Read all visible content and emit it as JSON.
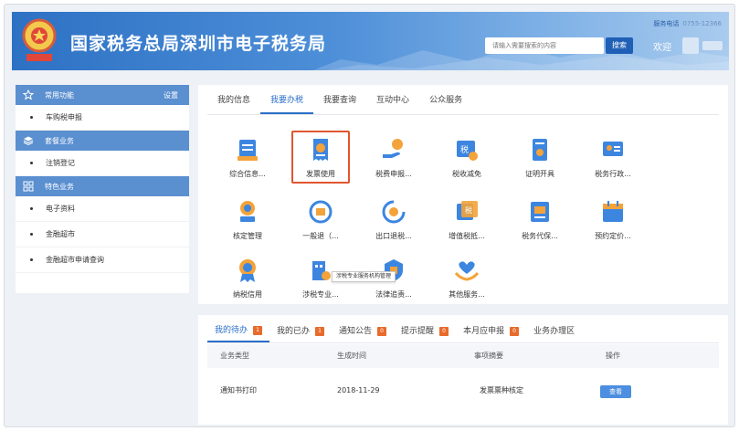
{
  "header": {
    "title": "国家税务总局深圳市电子税务局",
    "service_phone_label": "服务电话",
    "service_phone": "0755-12366",
    "search_placeholder": "请输入需要搜索的内容",
    "search_button": "搜索",
    "welcome": "欢迎"
  },
  "sidebar": {
    "sections": [
      {
        "label": "常用功能",
        "right": "设置",
        "icon": "star-icon",
        "items": [
          "车购税申报"
        ]
      },
      {
        "label": "套餐业务",
        "right": "",
        "icon": "package-icon",
        "items": [
          "注销登记"
        ]
      },
      {
        "label": "特色业务",
        "right": "",
        "icon": "grid-icon",
        "items": [
          "电子资料",
          "金融超市",
          "金融超市申请查询"
        ]
      }
    ]
  },
  "main": {
    "tabs": [
      {
        "label": "我的信息",
        "active": false
      },
      {
        "label": "我要办税",
        "active": true
      },
      {
        "label": "我要查询",
        "active": false
      },
      {
        "label": "互动中心",
        "active": false
      },
      {
        "label": "公众服务",
        "active": false
      }
    ],
    "grid": [
      {
        "label": "综合信息...",
        "icon": "document-stack-icon",
        "selected": false
      },
      {
        "label": "发票使用",
        "icon": "invoice-icon",
        "selected": true
      },
      {
        "label": "税费申报...",
        "icon": "hand-coin-icon",
        "selected": false
      },
      {
        "label": "税收减免",
        "icon": "tax-relief-icon",
        "selected": false
      },
      {
        "label": "证明开具",
        "icon": "certificate-icon",
        "selected": false
      },
      {
        "label": "税务行政...",
        "icon": "admin-icon",
        "selected": false
      },
      {
        "label": "核定管理",
        "icon": "stamp-icon",
        "selected": false
      },
      {
        "label": "一般退（...",
        "icon": "refund-icon",
        "selected": false
      },
      {
        "label": "出口退税...",
        "icon": "export-refund-icon",
        "selected": false
      },
      {
        "label": "增值税抵...",
        "icon": "vat-icon",
        "selected": false
      },
      {
        "label": "税务代保...",
        "icon": "custody-icon",
        "selected": false
      },
      {
        "label": "预约定价...",
        "icon": "calendar-icon",
        "selected": false
      },
      {
        "label": "纳税信用",
        "icon": "credit-medal-icon",
        "selected": false
      },
      {
        "label": "涉税专业...",
        "icon": "building-icon",
        "selected": false
      },
      {
        "label": "法律追责...",
        "icon": "law-icon",
        "selected": false
      },
      {
        "label": "其他服务...",
        "icon": "heart-hands-icon",
        "selected": false
      }
    ],
    "tooltip": "涉税专业服务机构管理"
  },
  "panel": {
    "tabs": [
      {
        "label": "我的待办",
        "badge": "1",
        "active": true
      },
      {
        "label": "我的已办",
        "badge": "1",
        "active": false
      },
      {
        "label": "通知公告",
        "badge": "0",
        "active": false
      },
      {
        "label": "提示提醒",
        "badge": "0",
        "active": false
      },
      {
        "label": "本月应申报",
        "badge": "0",
        "active": false
      },
      {
        "label": "业务办理区",
        "badge": "",
        "active": false
      }
    ],
    "columns": [
      "业务类型",
      "生成时间",
      "事项摘要",
      "操作"
    ],
    "rows": [
      {
        "type": "通知书打印",
        "time": "2018-11-29",
        "summary": "发票票种核定",
        "action": "查看"
      }
    ]
  },
  "colors": {
    "header_blue": "#2d71c4",
    "sidebar_section": "#5a8fd0",
    "active_tab": "#2a6fc9",
    "badge": "#e76b2b",
    "selected_border": "#e0562f"
  }
}
